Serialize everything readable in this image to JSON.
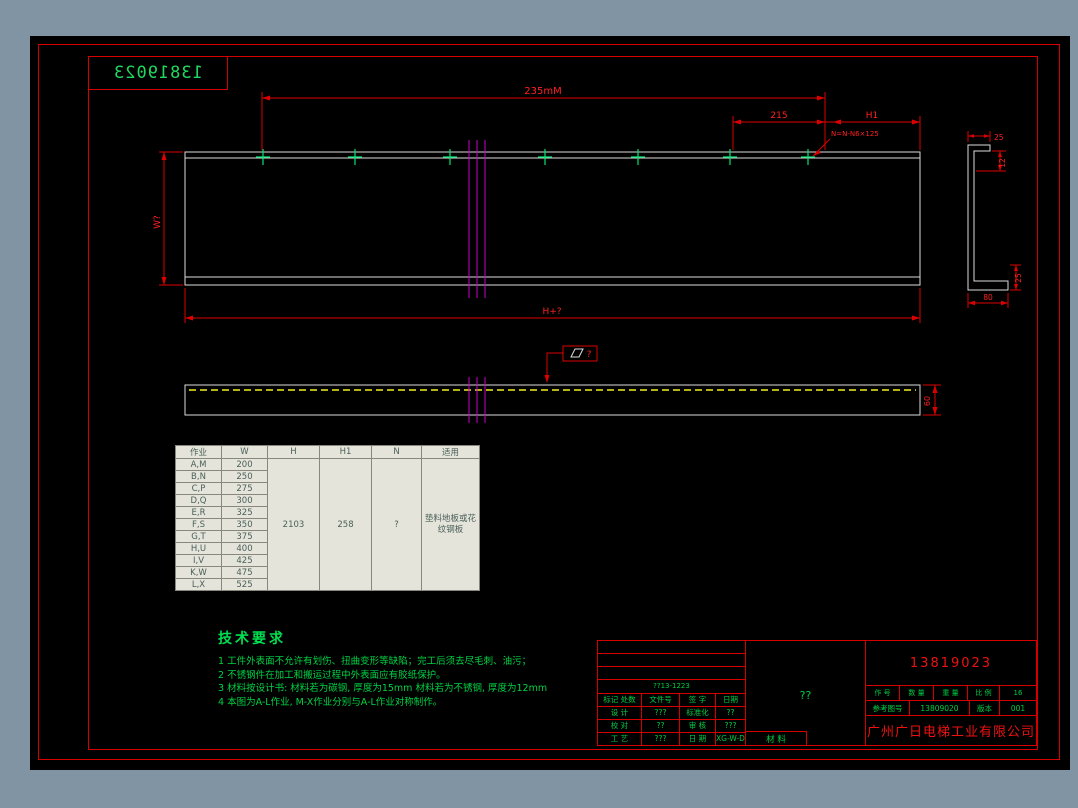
{
  "page": {
    "stamp_number": "13819023"
  },
  "colors": {
    "background": "#8194a3",
    "canvas": "#000000",
    "frame_red": "#d40000",
    "dimension_red": "#ff2020",
    "annotation_green": "#00dc46",
    "hole_marker_green": "#00e673",
    "centerline_magenta": "#cc00cc",
    "hidden_line_yellow": "#f0f020"
  },
  "drawing": {
    "dims": {
      "top_total": "235mM",
      "top_right": "215",
      "h1": "H1",
      "hole_note": "N=N-N6×125",
      "left_height": "W?",
      "bottom_total": "H+?",
      "plan_height": "60",
      "sec_top": "25",
      "sec_lip": "12",
      "sec_right": "25",
      "sec_bottom": "80",
      "finish_label": "?"
    }
  },
  "table": {
    "headers": [
      "作业",
      "W",
      "H",
      "H1",
      "N",
      "适用"
    ],
    "rows": [
      [
        "A,M",
        "200"
      ],
      [
        "B,N",
        "250"
      ],
      [
        "C,P",
        "275"
      ],
      [
        "D,Q",
        "300"
      ],
      [
        "E,R",
        "325"
      ],
      [
        "F,S",
        "350"
      ],
      [
        "G,T",
        "375"
      ],
      [
        "H,U",
        "400"
      ],
      [
        "I,V",
        "425"
      ],
      [
        "K,W",
        "475"
      ],
      [
        "L,X",
        "525"
      ]
    ],
    "h_value": "2103",
    "h1_value": "258",
    "n_value": "?",
    "usage": "垫料地板或花纹钢板"
  },
  "tech": {
    "title": "技术要求",
    "items": [
      "1 工件外表面不允许有划伤、扭曲变形等缺陷；完工后须去尽毛刺、油污；",
      "2 不锈钢件在加工和搬运过程中外表面应有胶纸保护。",
      "3 材料按设计书: 材料若为碳钢, 厚度为15mm  材料若为不锈钢, 厚度为12mm",
      "4 本图为A-L作业, M-X作业分别与A-L作业对称制作。"
    ]
  },
  "titleblock": {
    "doc_code": "??13-1223",
    "rev_header": [
      "标记 处数",
      "文件号",
      "签 字",
      "日期"
    ],
    "sign_rows": [
      [
        "设 计",
        "???",
        "标准化",
        "??"
      ],
      [
        "校 对",
        "??",
        "审 核",
        "???"
      ],
      [
        "工 艺",
        "???",
        "日 期",
        "XG-W-D"
      ]
    ],
    "material_label": "材 料",
    "product_code": "??",
    "drawing_number": "13819023",
    "info_headers": [
      "作 号",
      "数 量",
      "重 量",
      "比 例"
    ],
    "sheet_no": "16",
    "ref_label": "参考图号",
    "ref_number": "13809020",
    "version_label": "版本",
    "version_value": "001",
    "company": "广州广日电梯工业有限公司"
  }
}
